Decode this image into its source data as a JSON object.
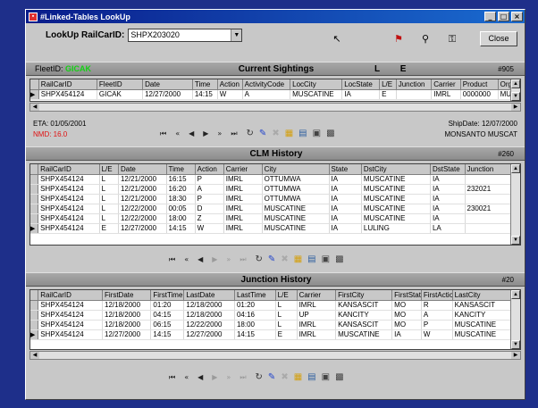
{
  "window": {
    "title": "#Linked-Tables LookUp",
    "min": "_",
    "max": "□",
    "close": "×"
  },
  "lookup": {
    "label": "LookUp RailCarID:",
    "value": "SHPX203020",
    "close_label": "Close"
  },
  "sightings": {
    "fleet_label": "FleetID:",
    "fleet_value": "GICAK",
    "title": "Current Sightings",
    "le": "L E",
    "count": "#905",
    "columns": [
      "RailCarID",
      "FleetID",
      "Date",
      "Time",
      "Action",
      "ActivityCode",
      "LocCity",
      "LocState",
      "L/E",
      "Junction",
      "Carrier",
      "Product",
      "OrgC"
    ],
    "rows": [
      [
        "SHPX454124",
        "GICAK",
        "12/27/2000",
        "14:15",
        "W",
        "A",
        "MUSCATINE",
        "IA",
        "E",
        "",
        "IMRL",
        "0000000",
        "MUS"
      ]
    ],
    "eta": "ETA: 01/05/2001",
    "nmd": "NMD: 16.0",
    "shipdate": "ShipDate: 12/07/2000",
    "ship_loc": "MONSANTO MUSCAT"
  },
  "clm": {
    "title": "CLM History",
    "count": "#260",
    "columns": [
      "RailCarID",
      "L/E",
      "Date",
      "Time",
      "Action",
      "Carrier",
      "City",
      "State",
      "DstCity",
      "DstState",
      "Junction"
    ],
    "rows": [
      [
        "SHPX454124",
        "L",
        "12/21/2000",
        "16:15",
        "P",
        "IMRL",
        "OTTUMWA",
        "IA",
        "MUSCATINE",
        "IA",
        ""
      ],
      [
        "SHPX454124",
        "L",
        "12/21/2000",
        "16:20",
        "A",
        "IMRL",
        "OTTUMWA",
        "IA",
        "MUSCATINE",
        "IA",
        "232021"
      ],
      [
        "SHPX454124",
        "L",
        "12/21/2000",
        "18:30",
        "P",
        "IMRL",
        "OTTUMWA",
        "IA",
        "MUSCATINE",
        "IA",
        ""
      ],
      [
        "SHPX454124",
        "L",
        "12/22/2000",
        "00:05",
        "D",
        "IMRL",
        "MUSCATINE",
        "IA",
        "MUSCATINE",
        "IA",
        "230021"
      ],
      [
        "SHPX454124",
        "L",
        "12/22/2000",
        "18:00",
        "Z",
        "IMRL",
        "MUSCATINE",
        "IA",
        "MUSCATINE",
        "IA",
        ""
      ],
      [
        "SHPX454124",
        "E",
        "12/27/2000",
        "14:15",
        "W",
        "IMRL",
        "MUSCATINE",
        "IA",
        "LULING",
        "LA",
        ""
      ]
    ]
  },
  "junction": {
    "title": "Junction History",
    "count": "#20",
    "columns": [
      "RailCarID",
      "FirstDate",
      "FirstTime",
      "LastDate",
      "LastTime",
      "L/E",
      "Carrier",
      "FirstCity",
      "FirstState",
      "FirstAction",
      "LastCity"
    ],
    "rows": [
      [
        "SHPX454124",
        "12/18/2000",
        "01:20",
        "12/18/2000",
        "01:20",
        "L",
        "IMRL",
        "KANSASCIT",
        "MO",
        "R",
        "KANSASCIT"
      ],
      [
        "SHPX454124",
        "12/18/2000",
        "04:15",
        "12/18/2000",
        "04:16",
        "L",
        "UP",
        "KANCITY",
        "MO",
        "A",
        "KANCITY"
      ],
      [
        "SHPX454124",
        "12/18/2000",
        "06:15",
        "12/22/2000",
        "18:00",
        "L",
        "IMRL",
        "KANSASCIT",
        "MO",
        "P",
        "MUSCATINE"
      ],
      [
        "SHPX454124",
        "12/27/2000",
        "14:15",
        "12/27/2000",
        "14:15",
        "E",
        "IMRL",
        "MUSCATINE",
        "IA",
        "W",
        "MUSCATINE"
      ]
    ]
  },
  "nav": {
    "first": "⏮",
    "prev_page": "«",
    "prev": "◀",
    "next": "▶",
    "next_page": "»",
    "last": "⏭"
  },
  "icons": [
    "flag-icon",
    "binoculars-icon",
    "lock-icon",
    "refresh-icon",
    "edit-icon",
    "cancel-icon",
    "filter-icon",
    "save-icon",
    "print-icon"
  ]
}
